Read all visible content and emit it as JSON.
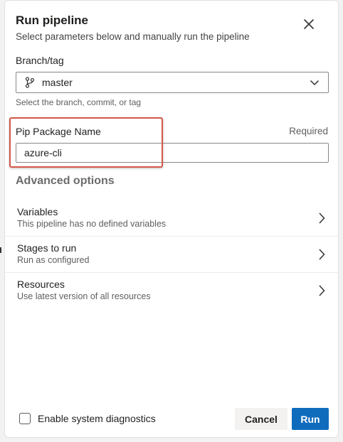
{
  "dialog": {
    "title": "Run pipeline",
    "subtitle": "Select parameters below and manually run the pipeline"
  },
  "branch": {
    "label": "Branch/tag",
    "value": "master",
    "hint": "Select the branch, commit, or tag"
  },
  "pip_package": {
    "label": "Pip Package Name",
    "required_text": "Required",
    "value": "azure-cli"
  },
  "advanced": {
    "heading": "Advanced options",
    "items": [
      {
        "title": "Variables",
        "subtitle": "This pipeline has no defined variables"
      },
      {
        "title": "Stages to run",
        "subtitle": "Run as configured"
      },
      {
        "title": "Resources",
        "subtitle": "Use latest version of all resources"
      }
    ]
  },
  "footer": {
    "diagnostics_label": "Enable system diagnostics",
    "diagnostics_checked": false,
    "cancel_label": "Cancel",
    "run_label": "Run"
  },
  "colors": {
    "primary": "#0f6cbd",
    "highlight": "#d4584a"
  },
  "icons": {
    "close": "close-icon",
    "branch": "git-branch-icon",
    "dropdown": "chevron-down-icon",
    "chevron_right": "chevron-right-icon"
  }
}
